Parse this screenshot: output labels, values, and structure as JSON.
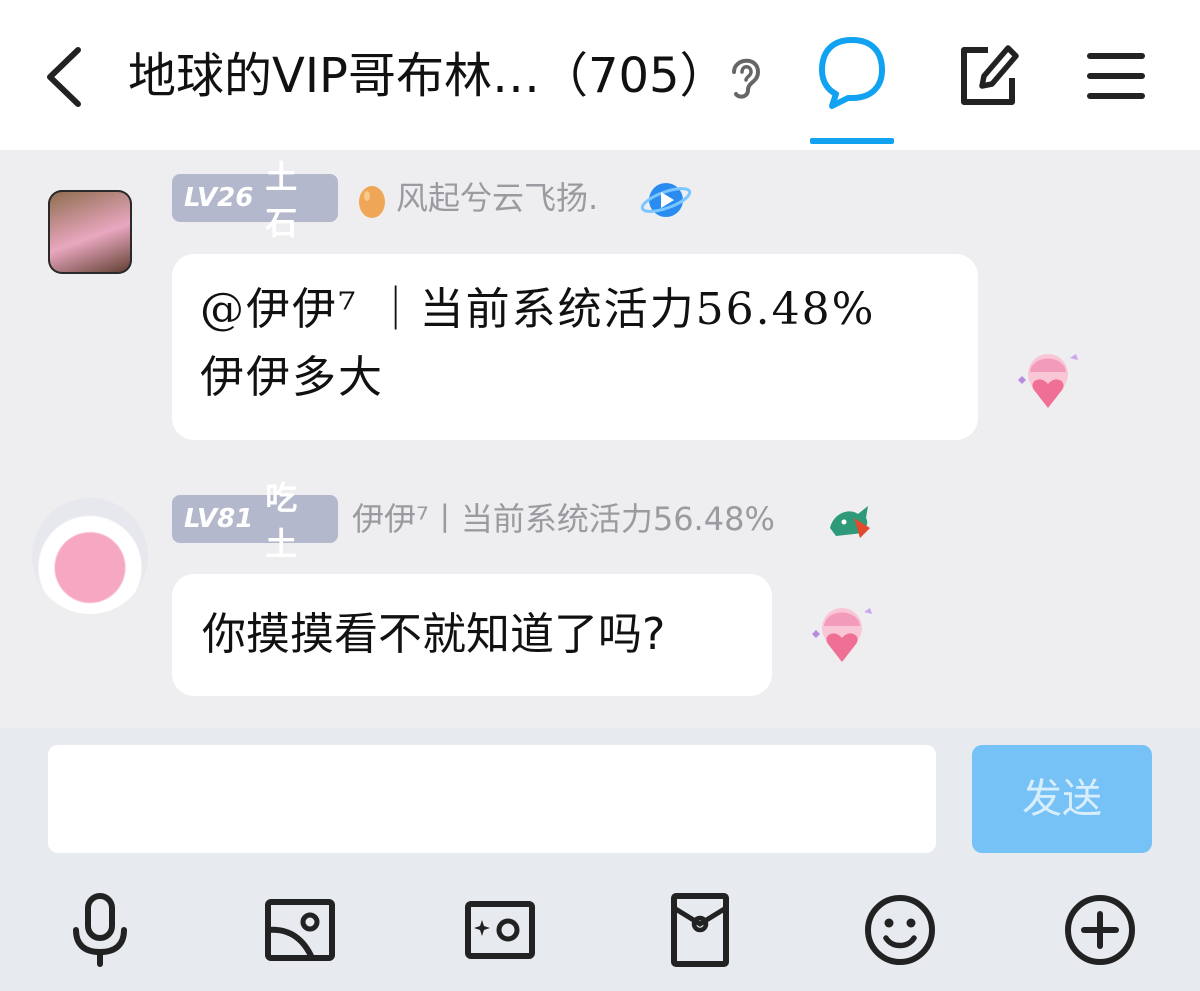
{
  "header": {
    "title": "地球的VIP哥布林…（705）"
  },
  "messages": [
    {
      "level": "LV26",
      "rank": "土石",
      "signature": "风起兮云飞扬.",
      "lines": [
        "@伊伊⁷ ｜当前系统活力56.48%",
        "伊伊多大"
      ]
    },
    {
      "level": "LV81",
      "rank": "吃土",
      "signature": "伊伊⁷丨当前系统活力56.48%",
      "text": "你摸摸看不就知道了吗?"
    }
  ],
  "input": {
    "placeholder": "",
    "send_label": "发送"
  },
  "colors": {
    "accent": "#12a2f2",
    "send_button": "#76c2f6",
    "badge": "#b4b8cc"
  },
  "icons": [
    "back-arrow-icon",
    "ear-icon",
    "chat-bubble-icon",
    "edit-icon",
    "menu-icon",
    "microphone-icon",
    "image-icon",
    "camera-icon",
    "red-packet-icon",
    "emoji-icon",
    "plus-icon"
  ]
}
